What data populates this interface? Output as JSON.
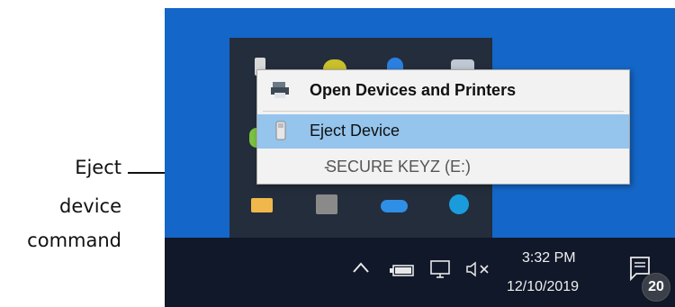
{
  "callout": {
    "line1": "Eject",
    "line2": "device",
    "line3": "command"
  },
  "context_menu": {
    "items": [
      {
        "label": "Open Devices and Printers",
        "icon": "printer-icon"
      },
      {
        "label": "Eject Device",
        "icon": "usb-drive-icon",
        "highlighted": true
      },
      {
        "label": "SECURE KEYZ (E:)",
        "prefix": "-"
      }
    ]
  },
  "overflow_tray_icons": [
    "usb-icon",
    "vmware-icon",
    "bluetooth-icon",
    "display-icon",
    "mail-icon",
    "network-drive-icon",
    "onedrive-icon",
    "skype-icon"
  ],
  "taskbar": {
    "time": "3:32 PM",
    "date": "12/10/2019",
    "notification_count": "20",
    "tray_icons": [
      "chevron-up-icon",
      "battery-icon",
      "network-icon",
      "volume-muted-icon"
    ]
  },
  "colors": {
    "desktop": "#1466c8",
    "taskbar": "#10182a",
    "menu_highlight": "#95c4ec"
  }
}
